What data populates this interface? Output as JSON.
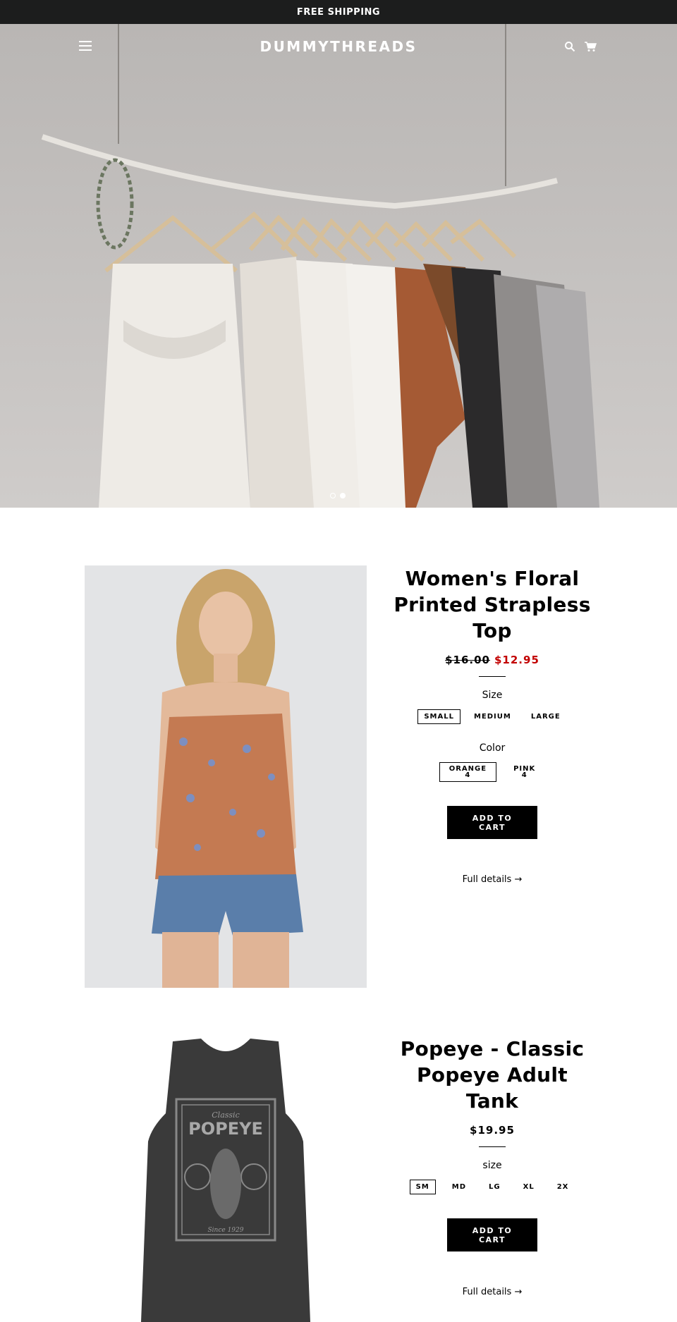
{
  "announcement": "FREE SHIPPING",
  "header": {
    "logo": "DUMMYTHREADS",
    "menu_icon": "hamburger-menu-icon",
    "search_icon": "search-icon",
    "cart_icon": "cart-icon"
  },
  "slideshow": {
    "slides": 2,
    "active_slide": 2
  },
  "products": [
    {
      "title": "Women's Floral Printed Strapless Top",
      "price_original": "$16.00",
      "price_sale": "$12.95",
      "options": [
        {
          "label": "Size",
          "values": [
            "SMALL",
            "MEDIUM",
            "LARGE"
          ],
          "selected": "SMALL"
        },
        {
          "label": "Color",
          "values": [
            [
              "ORANGE",
              "4"
            ],
            [
              "PINK",
              "4"
            ]
          ],
          "selected": "ORANGE"
        }
      ],
      "add_to_cart": [
        "ADD TO",
        "CART"
      ],
      "full_details": "Full details →"
    },
    {
      "title": "Popeye - Classic Popeye Adult Tank",
      "price": "$19.95",
      "options": [
        {
          "label": "size",
          "values": [
            "SM",
            "MD",
            "LG",
            "XL",
            "2X"
          ],
          "selected": "SM"
        }
      ],
      "add_to_cart": [
        "ADD TO",
        "CART"
      ],
      "full_details": "Full details →",
      "graphic_text": {
        "classic": "Classic",
        "name": "POPEYE",
        "since": "Since 1929"
      }
    }
  ],
  "colors": {
    "announce_bg": "#1c1d1d",
    "sale_red": "#c20000",
    "button_bg": "#000000"
  }
}
